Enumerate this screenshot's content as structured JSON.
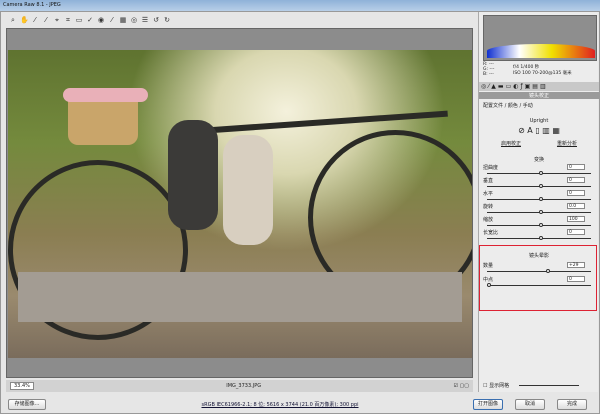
{
  "window": {
    "title": "Camera Raw 8.1 - JPEG"
  },
  "toolbar": {
    "tools": [
      "zoom-icon",
      "hand-icon",
      "white-balance-icon",
      "color-sampler-icon",
      "targeted-adjustment-icon",
      "crop-icon",
      "straighten-icon",
      "spot-removal-icon",
      "red-eye-icon",
      "adjustment-brush-icon",
      "graduated-filter-icon",
      "radial-filter-icon",
      "preferences-icon",
      "rotate-left-icon",
      "rotate-right-icon"
    ],
    "glyphs": [
      "⌕",
      "✋",
      "⁄",
      "⁄",
      "⌖",
      "⌗",
      "▭",
      "✓",
      "◉",
      "⁄",
      "▦",
      "◎",
      "☰",
      "↺",
      "↻"
    ]
  },
  "histogram": {
    "r": "R:",
    "g": "G:",
    "b": "B:",
    "rv": "---",
    "gv": "---",
    "bv": "---",
    "exposure": "f/4  1/400 秒",
    "iso": "ISO 100  70-200@135 毫米"
  },
  "panel": {
    "title": "镜头校正",
    "subtabs": "配置文件 / 颜色 / 手动",
    "upright": "Upright",
    "upright_links": [
      "启用校正",
      "重新分析"
    ],
    "transform_title": "变换",
    "transform": [
      {
        "label": "扭曲度",
        "value": "0",
        "pos": 0.5
      },
      {
        "label": "垂直",
        "value": "0",
        "pos": 0.5
      },
      {
        "label": "水平",
        "value": "0",
        "pos": 0.5
      },
      {
        "label": "旋转",
        "value": "0.0",
        "pos": 0.5
      },
      {
        "label": "缩放",
        "value": "100",
        "pos": 0.5
      },
      {
        "label": "长宽比",
        "value": "0",
        "pos": 0.5
      }
    ],
    "vignette_title": "镜头晕影",
    "vignette": [
      {
        "label": "数量",
        "value": "+29",
        "pos": 0.57
      },
      {
        "label": "中点",
        "value": "0",
        "pos": 0.0
      }
    ],
    "grid_label": "显示网格"
  },
  "status": {
    "zoom": "33.4%",
    "filename": "IMG_3733.JPG"
  },
  "footer": {
    "save": "存储图像...",
    "workflow": "sRGB IEC61966-2.1; 8 位; 5616 x 3744 (21.0 百万像素); 300 ppi",
    "open": "打开图像",
    "cancel": "取消",
    "done": "完成"
  }
}
